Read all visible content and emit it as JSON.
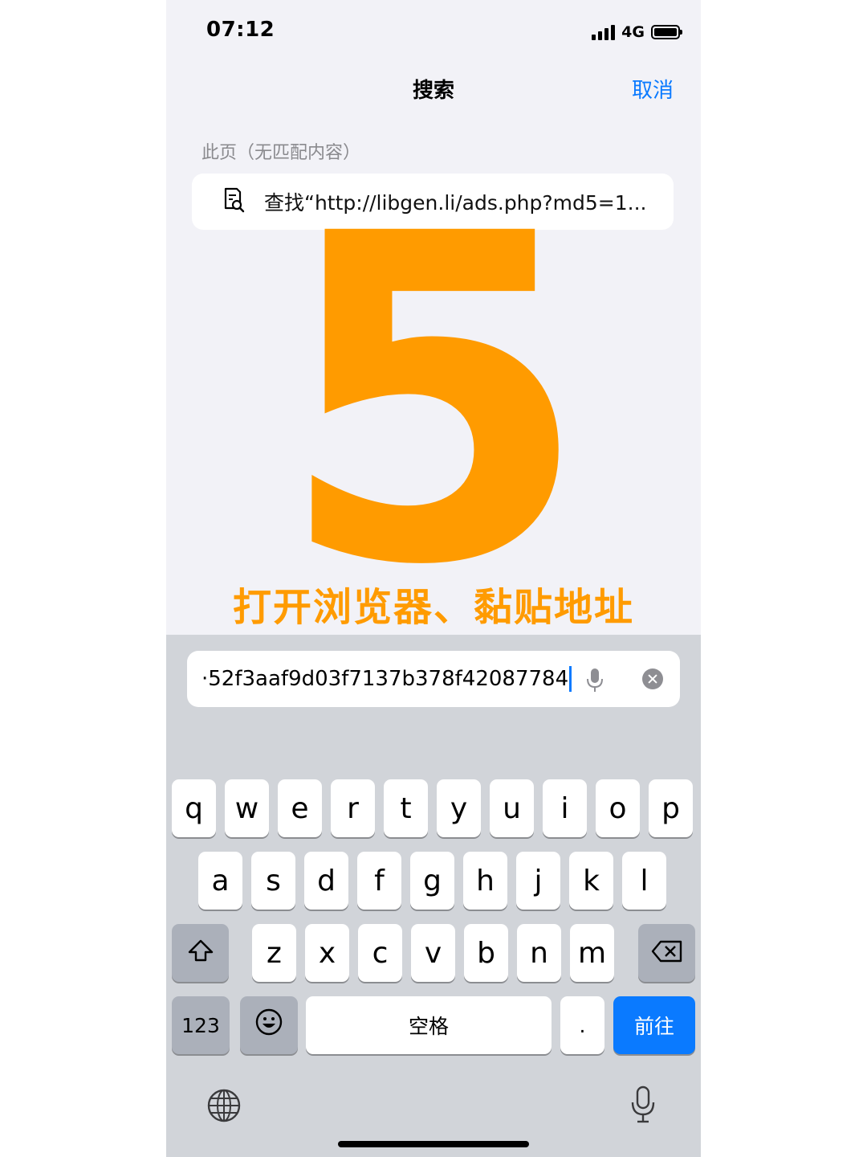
{
  "status": {
    "time": "07:12",
    "network": "4G"
  },
  "header": {
    "title": "搜索",
    "cancel": "取消"
  },
  "section_label": "此页（无匹配内容）",
  "find_row": {
    "text": "查找“http://libgen.li/ads.php?md5=1..."
  },
  "overlay": {
    "number": "5",
    "caption": "打开浏览器、黏贴地址"
  },
  "url_field": {
    "value": "·52f3aaf9d03f7137b378f42087784"
  },
  "keyboard": {
    "row1": [
      "q",
      "w",
      "e",
      "r",
      "t",
      "y",
      "u",
      "i",
      "o",
      "p"
    ],
    "row2": [
      "a",
      "s",
      "d",
      "f",
      "g",
      "h",
      "j",
      "k",
      "l"
    ],
    "row3": [
      "z",
      "x",
      "c",
      "v",
      "b",
      "n",
      "m"
    ],
    "numbers": "123",
    "space": "空格",
    "period": ".",
    "go": "前往"
  },
  "colors": {
    "accent": "#0a7aff",
    "annotation": "#ff9b00"
  }
}
